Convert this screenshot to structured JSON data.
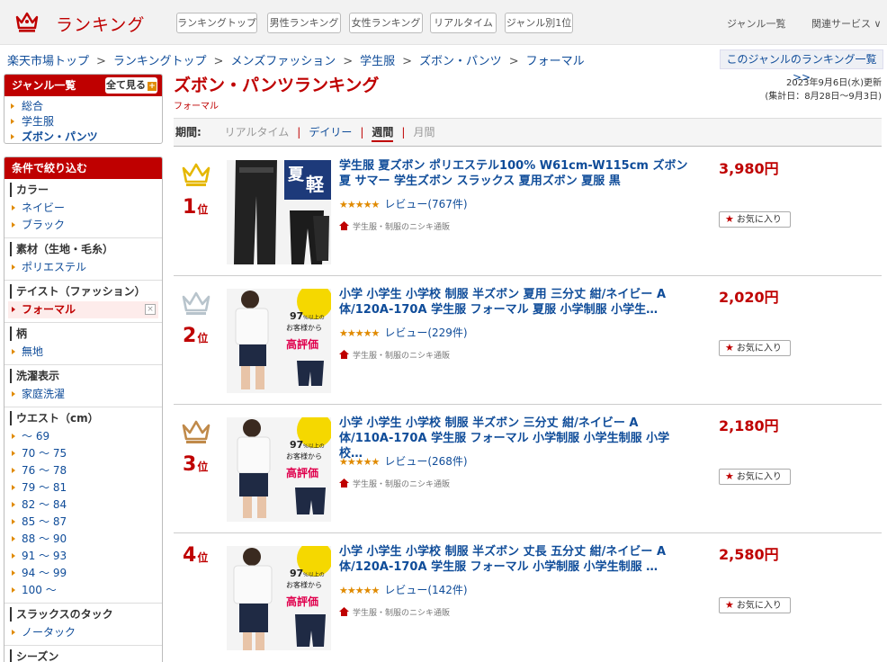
{
  "header": {
    "logo_text": "ランキング",
    "nav": [
      "ランキングトップ",
      "男性ランキング",
      "女性ランキング",
      "リアルタイム",
      "ジャンル別1位"
    ],
    "genre_list": "ジャンル一覧",
    "related": "関連サービス ∨"
  },
  "breadcrumb": [
    "楽天市場トップ",
    "ランキングトップ",
    "メンズファッション",
    "学生服",
    "ズボン・パンツ",
    "フォーマル"
  ],
  "genre_ranking_link": "このジャンルのランキング一覧 >>",
  "sidebar": {
    "genre_title": "ジャンル一覧",
    "show_all": "全て見る",
    "genres": [
      "総合",
      "学生服",
      "ズボン・パンツ"
    ],
    "filter_title": "条件で絞り込む",
    "filters": [
      {
        "title": "カラー",
        "items": [
          "ネイビー",
          "ブラック"
        ]
      },
      {
        "title": "素材（生地・毛糸）",
        "items": [
          "ポリエステル"
        ]
      },
      {
        "title": "テイスト（ファッション）",
        "items": [
          "フォーマル"
        ],
        "selected": "フォーマル"
      },
      {
        "title": "柄",
        "items": [
          "無地"
        ]
      },
      {
        "title": "洗濯表示",
        "items": [
          "家庭洗濯"
        ]
      },
      {
        "title": "ウエスト（cm）",
        "items": [
          "～ 69",
          "70 ～ 75",
          "76 ～ 78",
          "79 ～ 81",
          "82 ～ 84",
          "85 ～ 87",
          "88 ～ 90",
          "91 ～ 93",
          "94 ～ 99",
          "100 ～"
        ]
      },
      {
        "title": "スラックスのタック",
        "items": [
          "ノータック"
        ]
      },
      {
        "title": "シーズン",
        "items": []
      }
    ]
  },
  "main": {
    "title": "ズボン・パンツランキング",
    "subtitle": "フォーマル",
    "updated": "2023年9月6日(水)更新",
    "period_total": "(集計日：8月28日～9月3日)",
    "period_label": "期間:",
    "periods": [
      "リアルタイム",
      "デイリー",
      "週間",
      "月間"
    ],
    "period_active": "週間"
  },
  "items": [
    {
      "rank": "1",
      "suffix": "位",
      "title": "学生服 夏ズボン ポリエステル100% W61cm-W115cm ズボン 夏 サマー 学生ズボン スラックス 夏用ズボン 夏服 黒",
      "stars": "★★★★★",
      "review": "レビュー(767件)",
      "shop": "学生服・制服のニシキ通販",
      "price": "3,980円",
      "fav": "お気に入り",
      "crown_color": "#e5b700",
      "rating": 4.5
    },
    {
      "rank": "2",
      "suffix": "位",
      "title": "小学 小学生 小学校 制服 半ズボン 夏用 三分丈 紺/ネイビー A体/120A-170A 学生服 フォーマル 夏服 小学制服 小学生…",
      "stars": "★★★★★",
      "review": "レビュー(229件)",
      "shop": "学生服・制服のニシキ通販",
      "price": "2,020円",
      "fav": "お気に入り",
      "crown_color": "#b8c4cc",
      "rating": 4.5
    },
    {
      "rank": "3",
      "suffix": "位",
      "title": "小学 小学生 小学校 制服 半ズボン 三分丈 紺/ネイビー A体/110A-170A 学生服 フォーマル 小学制服 小学生制服 小学校…",
      "stars": "★★★★★",
      "review": "レビュー(268件)",
      "shop": "学生服・制服のニシキ通販",
      "price": "2,180円",
      "fav": "お気に入り",
      "crown_color": "#c08a4a",
      "rating": 4.5
    },
    {
      "rank": "4",
      "suffix": "位",
      "title": "小学 小学生 小学校 制服 半ズボン 丈長 五分丈 紺/ネイビー A体/120A-170A 学生服 フォーマル 小学制服 小学生制服 …",
      "stars": "★★★★★",
      "review": "レビュー(142件)",
      "shop": "学生服・制服のニシキ通販",
      "price": "2,580円",
      "fav": "お気に入り",
      "crown_color": "",
      "rating": 4.5
    }
  ],
  "thumb_texts": {
    "item1": {
      "badge1": "夏",
      "badge2": "軽"
    },
    "item2": {
      "pct": "97",
      "line1": "%以上の",
      "line2": "お客様から",
      "line3": "高評価"
    }
  },
  "colors": {
    "accent": "#bf0000",
    "link": "#0f4c99",
    "star": "#e08a00"
  }
}
